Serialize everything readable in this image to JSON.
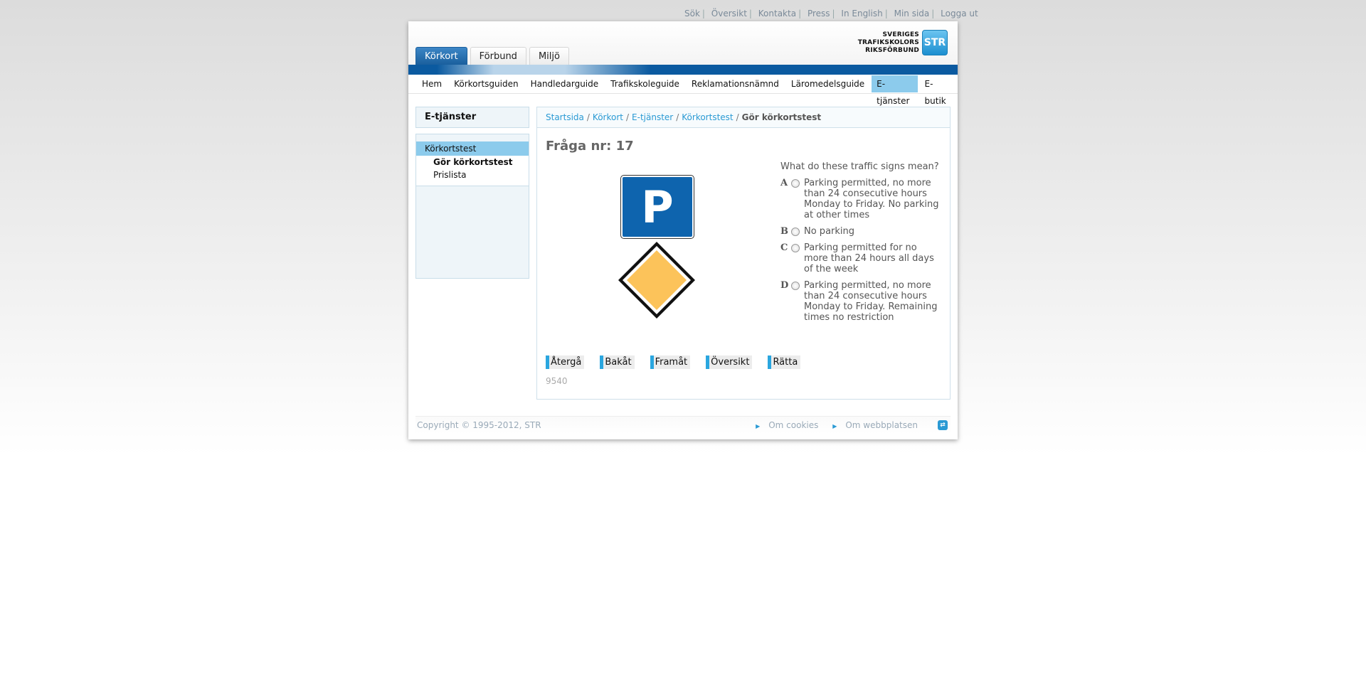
{
  "top_links": [
    "Sök",
    "Översikt",
    "Kontakta",
    "Press",
    "In English",
    "Min sida",
    "Logga ut"
  ],
  "logo": {
    "lines": [
      "SVERIGES",
      "TRAFIKSKOLORS",
      "RIKSFÖRBUND"
    ],
    "mark": "STR"
  },
  "tabs": [
    "Körkort",
    "Förbund",
    "Miljö"
  ],
  "main_nav": [
    "Hem",
    "Körkortsguiden",
    "Handledarguide",
    "Trafikskoleguide",
    "Reklamationsnämnd",
    "Läromedelsguide",
    "E-tjänster",
    "E-butik"
  ],
  "sidebar": {
    "title": "E-tjänster",
    "items": [
      "Körkortstest",
      "Gör körkortstest",
      "Prislista"
    ]
  },
  "breadcrumb": {
    "links": [
      "Startsida",
      "Körkort",
      "E-tjänster",
      "Körkortstest"
    ],
    "current": "Gör körkortstest"
  },
  "question": {
    "title": "Fråga nr: 17",
    "text": "What do these traffic signs mean?",
    "options": [
      {
        "letter": "A",
        "text": "Parking permitted, no more than 24 consecutive hours Monday to Friday. No parking at other times"
      },
      {
        "letter": "B",
        "text": "No parking"
      },
      {
        "letter": "C",
        "text": "Parking permitted for no more than 24 hours all days of the week"
      },
      {
        "letter": "D",
        "text": "Parking permitted, no more than 24 consecutive hours Monday to Friday. Remaining times no restriction"
      }
    ],
    "sign_p_letter": "P",
    "id": "9540"
  },
  "buttons": [
    "Återgå",
    "Bakåt",
    "Framåt",
    "Översikt",
    "Rätta"
  ],
  "footer": {
    "copyright": "Copyright © 1995-2012, STR",
    "links": [
      "Om cookies",
      "Om webbplatsen"
    ]
  },
  "colors": {
    "brand_blue": "#0b5aa0",
    "accent": "#2a9ad4",
    "highlight": "#8ccbec",
    "diamond": "#fcc35a"
  }
}
